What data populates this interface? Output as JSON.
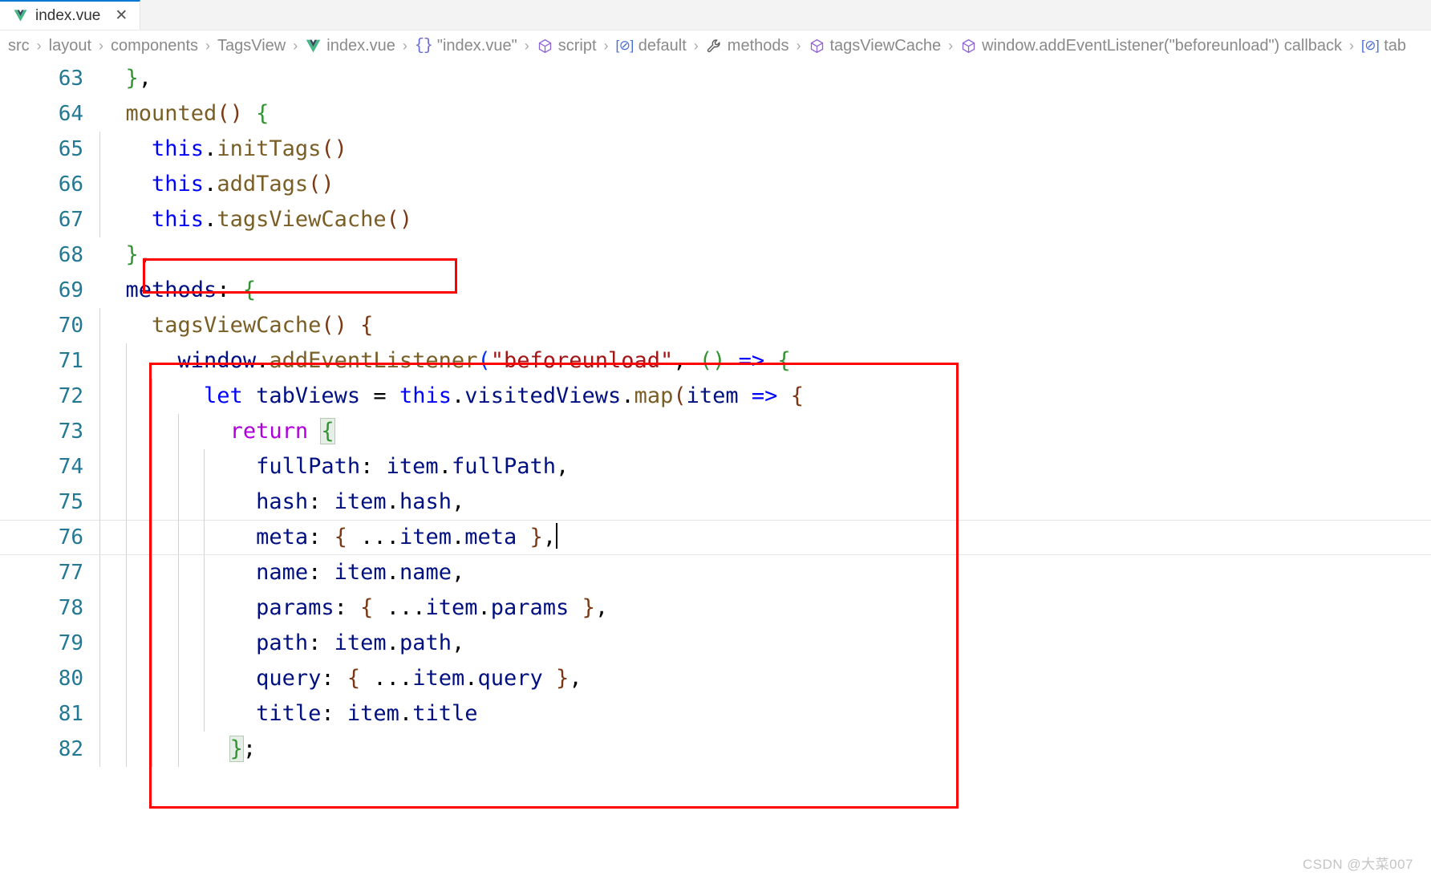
{
  "window": {
    "accent_color": "#0078d4",
    "background": "#ffffff"
  },
  "tabbar": {
    "tabs": [
      {
        "label": "index.vue",
        "icon": "vue-file-icon",
        "close_label": "✕",
        "active": true
      }
    ]
  },
  "breadcrumb": {
    "items": [
      {
        "label": "src",
        "icon": "none"
      },
      {
        "label": "layout",
        "icon": "none"
      },
      {
        "label": "components",
        "icon": "none"
      },
      {
        "label": "TagsView",
        "icon": "none"
      },
      {
        "label": "index.vue",
        "icon": "vue-file-icon"
      },
      {
        "label": "\"index.vue\"",
        "icon": "braces-symbol-icon"
      },
      {
        "label": "script",
        "icon": "module-symbol-icon"
      },
      {
        "label": "default",
        "icon": "property-symbol-icon"
      },
      {
        "label": "methods",
        "icon": "wrench-symbol-icon"
      },
      {
        "label": "tagsViewCache",
        "icon": "module-symbol-icon"
      },
      {
        "label": "window.addEventListener(\"beforeunload\") callback",
        "icon": "module-symbol-icon"
      },
      {
        "label": "tab",
        "icon": "property-symbol-icon"
      }
    ],
    "separator": "›"
  },
  "editor": {
    "language": "vue",
    "first_visible_line": 63,
    "cursor_line": 76,
    "cursor_column_text": "after '},'",
    "lines": [
      {
        "no": "63",
        "indent_guides": 0,
        "tokens": [
          {
            "t": "  ",
            "c": "t-plain"
          },
          {
            "t": "}",
            "c": "t-brace-g"
          },
          {
            "t": ",",
            "c": "t-punct"
          }
        ]
      },
      {
        "no": "64",
        "indent_guides": 0,
        "tokens": [
          {
            "t": "  ",
            "c": "t-plain"
          },
          {
            "t": "mounted",
            "c": "t-fn"
          },
          {
            "t": "(",
            "c": "t-paren3"
          },
          {
            "t": ")",
            "c": "t-paren3"
          },
          {
            "t": " ",
            "c": "t-plain"
          },
          {
            "t": "{",
            "c": "t-brace-g"
          }
        ]
      },
      {
        "no": "65",
        "indent_guides": 1,
        "tokens": [
          {
            "t": "    ",
            "c": "t-plain"
          },
          {
            "t": "this",
            "c": "t-kw"
          },
          {
            "t": ".",
            "c": "t-punct"
          },
          {
            "t": "initTags",
            "c": "t-fn"
          },
          {
            "t": "(",
            "c": "t-paren3"
          },
          {
            "t": ")",
            "c": "t-paren3"
          }
        ]
      },
      {
        "no": "66",
        "indent_guides": 1,
        "tokens": [
          {
            "t": "    ",
            "c": "t-plain"
          },
          {
            "t": "this",
            "c": "t-kw"
          },
          {
            "t": ".",
            "c": "t-punct"
          },
          {
            "t": "addTags",
            "c": "t-fn"
          },
          {
            "t": "(",
            "c": "t-paren3"
          },
          {
            "t": ")",
            "c": "t-paren3"
          }
        ]
      },
      {
        "no": "67",
        "indent_guides": 1,
        "tokens": [
          {
            "t": "    ",
            "c": "t-plain"
          },
          {
            "t": "this",
            "c": "t-kw"
          },
          {
            "t": ".",
            "c": "t-punct"
          },
          {
            "t": "tagsViewCache",
            "c": "t-fn"
          },
          {
            "t": "(",
            "c": "t-paren3"
          },
          {
            "t": ")",
            "c": "t-paren3"
          }
        ]
      },
      {
        "no": "68",
        "indent_guides": 0,
        "tokens": [
          {
            "t": "  ",
            "c": "t-plain"
          },
          {
            "t": "}",
            "c": "t-brace-g"
          },
          {
            "t": ",",
            "c": "t-punct"
          }
        ]
      },
      {
        "no": "69",
        "indent_guides": 0,
        "tokens": [
          {
            "t": "  ",
            "c": "t-plain"
          },
          {
            "t": "methods",
            "c": "t-prop"
          },
          {
            "t": ":",
            "c": "t-punct"
          },
          {
            "t": " ",
            "c": "t-plain"
          },
          {
            "t": "{",
            "c": "t-brace-g"
          }
        ]
      },
      {
        "no": "70",
        "indent_guides": 1,
        "tokens": [
          {
            "t": "    ",
            "c": "t-plain"
          },
          {
            "t": "tagsViewCache",
            "c": "t-fn"
          },
          {
            "t": "(",
            "c": "t-paren3"
          },
          {
            "t": ")",
            "c": "t-paren3"
          },
          {
            "t": " ",
            "c": "t-plain"
          },
          {
            "t": "{",
            "c": "t-brace-o"
          }
        ]
      },
      {
        "no": "71",
        "indent_guides": 2,
        "tokens": [
          {
            "t": "      ",
            "c": "t-plain"
          },
          {
            "t": "window",
            "c": "t-prop"
          },
          {
            "t": ".",
            "c": "t-punct"
          },
          {
            "t": "addEventListener",
            "c": "t-fn"
          },
          {
            "t": "(",
            "c": "t-paren1"
          },
          {
            "t": "\"beforeunload\"",
            "c": "t-str"
          },
          {
            "t": ", ",
            "c": "t-punct"
          },
          {
            "t": "(",
            "c": "t-paren2"
          },
          {
            "t": ")",
            "c": "t-paren2"
          },
          {
            "t": " ",
            "c": "t-plain"
          },
          {
            "t": "=>",
            "c": "t-kw"
          },
          {
            "t": " ",
            "c": "t-plain"
          },
          {
            "t": "{",
            "c": "t-brace-g"
          }
        ]
      },
      {
        "no": "72",
        "indent_guides": 3,
        "tokens": [
          {
            "t": "        ",
            "c": "t-plain"
          },
          {
            "t": "let",
            "c": "t-kw"
          },
          {
            "t": " ",
            "c": "t-plain"
          },
          {
            "t": "tabViews",
            "c": "t-prop"
          },
          {
            "t": " ",
            "c": "t-plain"
          },
          {
            "t": "=",
            "c": "t-punct"
          },
          {
            "t": " ",
            "c": "t-plain"
          },
          {
            "t": "this",
            "c": "t-kw"
          },
          {
            "t": ".",
            "c": "t-punct"
          },
          {
            "t": "visitedViews",
            "c": "t-prop"
          },
          {
            "t": ".",
            "c": "t-punct"
          },
          {
            "t": "map",
            "c": "t-fn"
          },
          {
            "t": "(",
            "c": "t-paren3"
          },
          {
            "t": "item",
            "c": "t-prop"
          },
          {
            "t": " ",
            "c": "t-plain"
          },
          {
            "t": "=>",
            "c": "t-kw"
          },
          {
            "t": " ",
            "c": "t-plain"
          },
          {
            "t": "{",
            "c": "t-brace-o"
          }
        ]
      },
      {
        "no": "73",
        "indent_guides": 4,
        "tokens": [
          {
            "t": "          ",
            "c": "t-plain"
          },
          {
            "t": "return",
            "c": "t-kwmag"
          },
          {
            "t": " ",
            "c": "t-plain"
          },
          {
            "t": "{",
            "c": "t-brace-g",
            "match": true
          }
        ]
      },
      {
        "no": "74",
        "indent_guides": 5,
        "tokens": [
          {
            "t": "            ",
            "c": "t-plain"
          },
          {
            "t": "fullPath",
            "c": "t-prop"
          },
          {
            "t": ":",
            "c": "t-punct"
          },
          {
            "t": " ",
            "c": "t-plain"
          },
          {
            "t": "item",
            "c": "t-prop"
          },
          {
            "t": ".",
            "c": "t-punct"
          },
          {
            "t": "fullPath",
            "c": "t-prop"
          },
          {
            "t": ",",
            "c": "t-punct"
          }
        ]
      },
      {
        "no": "75",
        "indent_guides": 5,
        "tokens": [
          {
            "t": "            ",
            "c": "t-plain"
          },
          {
            "t": "hash",
            "c": "t-prop"
          },
          {
            "t": ":",
            "c": "t-punct"
          },
          {
            "t": " ",
            "c": "t-plain"
          },
          {
            "t": "item",
            "c": "t-prop"
          },
          {
            "t": ".",
            "c": "t-punct"
          },
          {
            "t": "hash",
            "c": "t-prop"
          },
          {
            "t": ",",
            "c": "t-punct"
          }
        ]
      },
      {
        "no": "76",
        "current": true,
        "indent_guides": 5,
        "tokens": [
          {
            "t": "            ",
            "c": "t-plain"
          },
          {
            "t": "meta",
            "c": "t-prop"
          },
          {
            "t": ":",
            "c": "t-punct"
          },
          {
            "t": " ",
            "c": "t-plain"
          },
          {
            "t": "{",
            "c": "t-brace-o"
          },
          {
            "t": " ",
            "c": "t-plain"
          },
          {
            "t": "...",
            "c": "t-punct"
          },
          {
            "t": "item",
            "c": "t-prop"
          },
          {
            "t": ".",
            "c": "t-punct"
          },
          {
            "t": "meta",
            "c": "t-prop"
          },
          {
            "t": " ",
            "c": "t-plain"
          },
          {
            "t": "}",
            "c": "t-brace-o"
          },
          {
            "t": ",",
            "c": "t-punct"
          },
          {
            "t": "|caret|",
            "c": "caret"
          }
        ]
      },
      {
        "no": "77",
        "indent_guides": 5,
        "tokens": [
          {
            "t": "            ",
            "c": "t-plain"
          },
          {
            "t": "name",
            "c": "t-prop"
          },
          {
            "t": ":",
            "c": "t-punct"
          },
          {
            "t": " ",
            "c": "t-plain"
          },
          {
            "t": "item",
            "c": "t-prop"
          },
          {
            "t": ".",
            "c": "t-punct"
          },
          {
            "t": "name",
            "c": "t-prop"
          },
          {
            "t": ",",
            "c": "t-punct"
          }
        ]
      },
      {
        "no": "78",
        "indent_guides": 5,
        "tokens": [
          {
            "t": "            ",
            "c": "t-plain"
          },
          {
            "t": "params",
            "c": "t-prop"
          },
          {
            "t": ":",
            "c": "t-punct"
          },
          {
            "t": " ",
            "c": "t-plain"
          },
          {
            "t": "{",
            "c": "t-brace-o"
          },
          {
            "t": " ",
            "c": "t-plain"
          },
          {
            "t": "...",
            "c": "t-punct"
          },
          {
            "t": "item",
            "c": "t-prop"
          },
          {
            "t": ".",
            "c": "t-punct"
          },
          {
            "t": "params",
            "c": "t-prop"
          },
          {
            "t": " ",
            "c": "t-plain"
          },
          {
            "t": "}",
            "c": "t-brace-o"
          },
          {
            "t": ",",
            "c": "t-punct"
          }
        ]
      },
      {
        "no": "79",
        "indent_guides": 5,
        "tokens": [
          {
            "t": "            ",
            "c": "t-plain"
          },
          {
            "t": "path",
            "c": "t-prop"
          },
          {
            "t": ":",
            "c": "t-punct"
          },
          {
            "t": " ",
            "c": "t-plain"
          },
          {
            "t": "item",
            "c": "t-prop"
          },
          {
            "t": ".",
            "c": "t-punct"
          },
          {
            "t": "path",
            "c": "t-prop"
          },
          {
            "t": ",",
            "c": "t-punct"
          }
        ]
      },
      {
        "no": "80",
        "indent_guides": 5,
        "tokens": [
          {
            "t": "            ",
            "c": "t-plain"
          },
          {
            "t": "query",
            "c": "t-prop"
          },
          {
            "t": ":",
            "c": "t-punct"
          },
          {
            "t": " ",
            "c": "t-plain"
          },
          {
            "t": "{",
            "c": "t-brace-o"
          },
          {
            "t": " ",
            "c": "t-plain"
          },
          {
            "t": "...",
            "c": "t-punct"
          },
          {
            "t": "item",
            "c": "t-prop"
          },
          {
            "t": ".",
            "c": "t-punct"
          },
          {
            "t": "query",
            "c": "t-prop"
          },
          {
            "t": " ",
            "c": "t-plain"
          },
          {
            "t": "}",
            "c": "t-brace-o"
          },
          {
            "t": ",",
            "c": "t-punct"
          }
        ]
      },
      {
        "no": "81",
        "indent_guides": 5,
        "tokens": [
          {
            "t": "            ",
            "c": "t-plain"
          },
          {
            "t": "title",
            "c": "t-prop"
          },
          {
            "t": ":",
            "c": "t-punct"
          },
          {
            "t": " ",
            "c": "t-plain"
          },
          {
            "t": "item",
            "c": "t-prop"
          },
          {
            "t": ".",
            "c": "t-punct"
          },
          {
            "t": "title",
            "c": "t-prop"
          }
        ]
      },
      {
        "no": "82",
        "indent_guides": 4,
        "tokens": [
          {
            "t": "          ",
            "c": "t-plain"
          },
          {
            "t": "}",
            "c": "t-brace-g",
            "match": true
          },
          {
            "t": ";",
            "c": "t-punct"
          }
        ]
      }
    ]
  },
  "annotations": {
    "boxes": [
      {
        "name": "highlight-box-tagsviewcache-call",
        "color": "#ff0000"
      },
      {
        "name": "highlight-box-tagsviewcache-method",
        "color": "#ff0000"
      }
    ]
  },
  "watermark": {
    "text": "CSDN @大菜007"
  }
}
